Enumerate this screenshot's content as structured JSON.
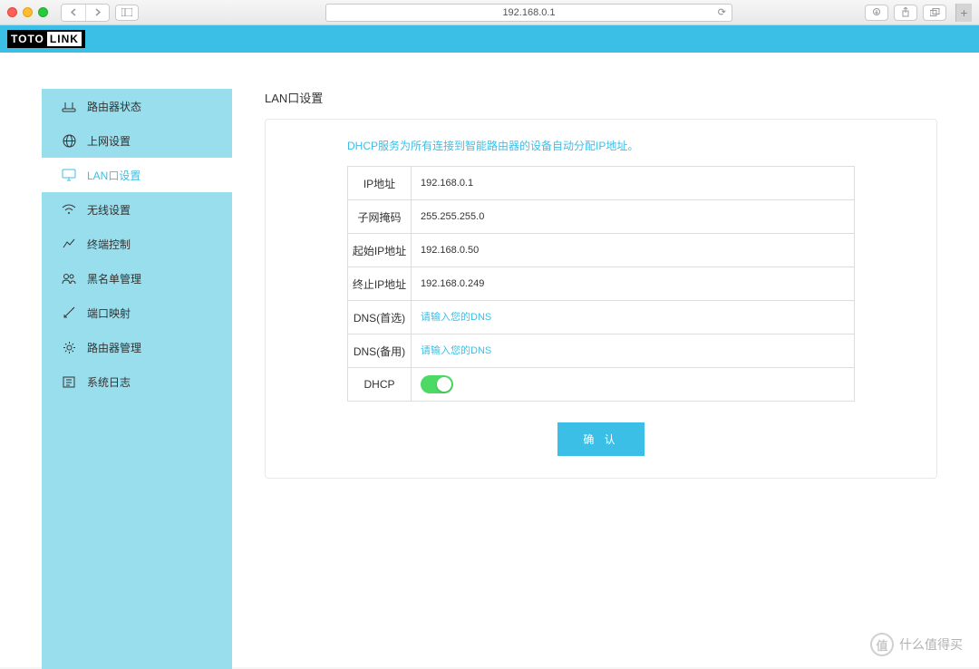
{
  "browser": {
    "url": "192.168.0.1"
  },
  "logo": {
    "toto": "TOTO",
    "link": "LINK"
  },
  "sidebar": {
    "items": [
      {
        "label": "路由器状态"
      },
      {
        "label": "上网设置"
      },
      {
        "label": "LAN口设置"
      },
      {
        "label": "无线设置"
      },
      {
        "label": "终端控制"
      },
      {
        "label": "黑名单管理"
      },
      {
        "label": "端口映射"
      },
      {
        "label": "路由器管理"
      },
      {
        "label": "系统日志"
      }
    ]
  },
  "content": {
    "title": "LAN口设置",
    "info": "DHCP服务为所有连接到智能路由器的设备自动分配IP地址。",
    "fields": {
      "ip_label": "IP地址",
      "ip_value": "192.168.0.1",
      "mask_label": "子网掩码",
      "mask_value": "255.255.255.0",
      "start_label": "起始IP地址",
      "start_value": "192.168.0.50",
      "end_label": "终止IP地址",
      "end_value": "192.168.0.249",
      "dns1_label": "DNS(首选)",
      "dns1_placeholder": "请输入您的DNS",
      "dns2_label": "DNS(备用)",
      "dns2_placeholder": "请输入您的DNS",
      "dhcp_label": "DHCP",
      "dhcp_on": true
    },
    "submit": "确 认"
  },
  "watermark": {
    "text": "什么值得买",
    "icon": "值"
  }
}
